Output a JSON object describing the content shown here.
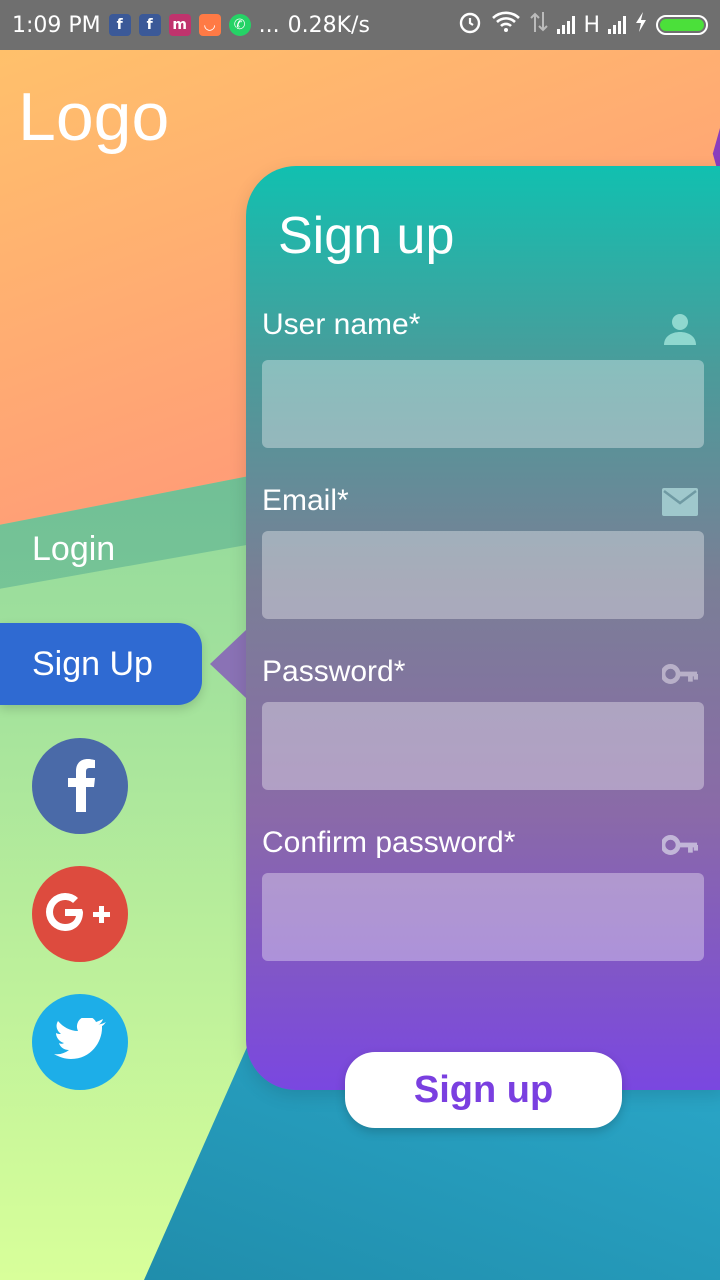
{
  "status_bar": {
    "time": "1:09 PM",
    "notification_icons": [
      "facebook-icon",
      "facebook-icon",
      "myntra-icon",
      "shopping-icon",
      "whatsapp-icon"
    ],
    "more": "...",
    "speed": "0.28K/s",
    "network_type": "H"
  },
  "logo": "Logo",
  "nav": {
    "login_label": "Login",
    "signup_label": "Sign Up"
  },
  "social": [
    "facebook-icon",
    "google-plus-icon",
    "twitter-icon"
  ],
  "card": {
    "title": "Sign up",
    "fields": [
      {
        "label": "User name*",
        "icon": "user-icon",
        "value": ""
      },
      {
        "label": "Email*",
        "icon": "mail-icon",
        "value": ""
      },
      {
        "label": "Password*",
        "icon": "key-icon",
        "value": ""
      },
      {
        "label": "Confirm password*",
        "icon": "key-icon",
        "value": ""
      }
    ],
    "submit_label": "Sign up"
  },
  "colors": {
    "nav_active": "#2f6ad2",
    "facebook": "#4a6aa8",
    "google_plus": "#dd4b3e",
    "twitter": "#1daee8",
    "submit_text": "#7a3fe0"
  }
}
